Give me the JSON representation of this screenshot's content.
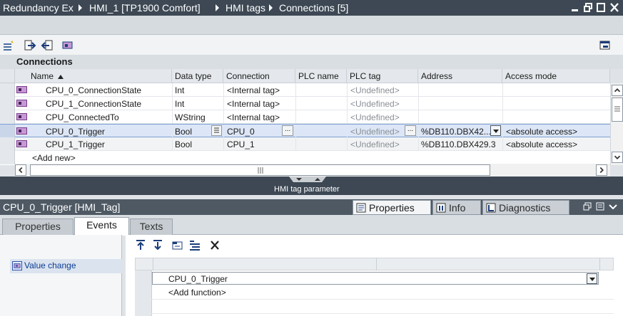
{
  "breadcrumb": {
    "items": [
      "Redundancy Ex",
      "HMI_1 [TP1900 Comfort]",
      "HMI tags",
      "Connections [5]"
    ]
  },
  "window_controls": [
    "minimize-icon",
    "restore-icon",
    "maximize-icon",
    "close-icon"
  ],
  "table": {
    "section_title": "Connections",
    "columns": [
      "Name",
      "Data type",
      "Connection",
      "PLC name",
      "PLC tag",
      "Address",
      "Access mode"
    ],
    "rows": [
      {
        "name": "CPU_0_ConnectionState",
        "data_type": "Int",
        "connection": "<Internal tag>",
        "plc_name": "",
        "plc_tag": "<Undefined>",
        "address": "",
        "access_mode": ""
      },
      {
        "name": "CPU_1_ConnectionState",
        "data_type": "Int",
        "connection": "<Internal tag>",
        "plc_name": "",
        "plc_tag": "<Undefined>",
        "address": "",
        "access_mode": ""
      },
      {
        "name": "CPU_ConnectedTo",
        "data_type": "WString",
        "connection": "<Internal tag>",
        "plc_name": "",
        "plc_tag": "<Undefined>",
        "address": "",
        "access_mode": ""
      },
      {
        "name": "CPU_0_Trigger",
        "data_type": "Bool",
        "connection": "CPU_0",
        "plc_name": "",
        "plc_tag": "<Undefined>",
        "address": "%DB110.DBX42...",
        "access_mode": "<absolute access>",
        "selected": true
      },
      {
        "name": "CPU_1_Trigger",
        "data_type": "Bool",
        "connection": "CPU_1",
        "plc_name": "",
        "plc_tag": "<Undefined>",
        "address": "%DB110.DBX429.3",
        "access_mode": "<absolute access>"
      }
    ],
    "add_new": "<Add new>",
    "ellipsis": "..."
  },
  "divider_label": "HMI tag parameter",
  "inspector": {
    "title": "CPU_0_Trigger [HMI_Tag]",
    "panel_tabs": [
      "Properties",
      "Info",
      "Diagnostics"
    ],
    "active_panel_tab": "Properties",
    "editor_tabs": [
      "Properties",
      "Events",
      "Texts"
    ],
    "active_editor_tab": "Events",
    "events": [
      "Value change"
    ],
    "function_list": {
      "items": [
        "CPU_0_Trigger"
      ],
      "add_function": "<Add function>"
    }
  },
  "colors": {
    "title_bar": "#3d4854",
    "selection": "#dce6f6",
    "tag_icon": "#7a3b8c"
  }
}
